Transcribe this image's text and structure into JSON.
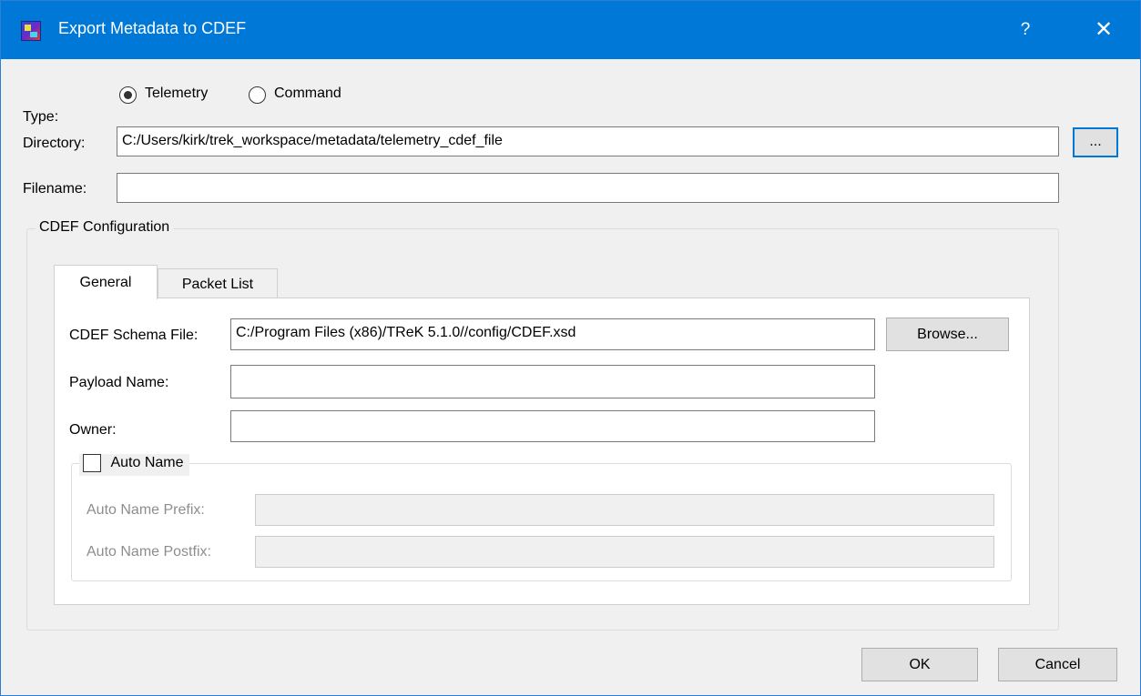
{
  "window": {
    "title": "Export Metadata to CDEF",
    "help_label": "?",
    "close_label": "✕"
  },
  "type": {
    "label": "Type:",
    "options": [
      {
        "label": "Telemetry",
        "selected": true
      },
      {
        "label": "Command",
        "selected": false
      }
    ]
  },
  "directory": {
    "label": "Directory:",
    "value": "C:/Users/kirk/trek_workspace/metadata/telemetry_cdef_file",
    "browse_label": "..."
  },
  "filename": {
    "label": "Filename:",
    "value": ""
  },
  "cdef_config": {
    "title": "CDEF Configuration",
    "tabs": [
      {
        "label": "General",
        "active": true
      },
      {
        "label": "Packet List",
        "active": false
      }
    ],
    "schema_file": {
      "label": "CDEF Schema File:",
      "value": "C:/Program Files (x86)/TReK 5.1.0//config/CDEF.xsd",
      "browse_label": "Browse..."
    },
    "payload_name": {
      "label": "Payload Name:",
      "value": ""
    },
    "owner": {
      "label": "Owner:",
      "value": ""
    },
    "auto_name": {
      "label": "Auto Name",
      "checked": false,
      "prefix_label": "Auto Name Prefix:",
      "prefix_value": "",
      "postfix_label": "Auto Name Postfix:",
      "postfix_value": ""
    }
  },
  "buttons": {
    "ok": "OK",
    "cancel": "Cancel"
  }
}
